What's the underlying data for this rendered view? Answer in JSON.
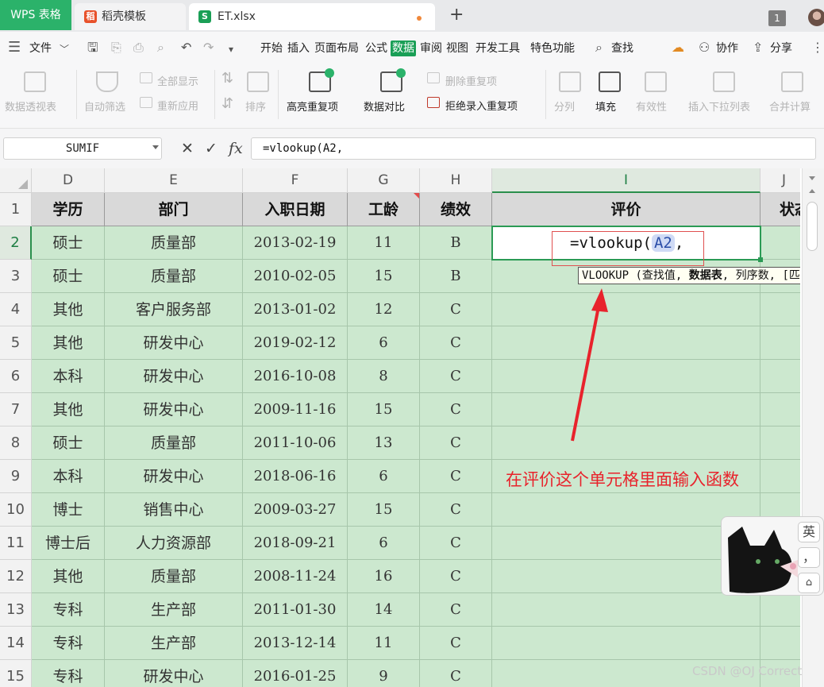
{
  "app": {
    "wps_tab_label": "WPS 表格",
    "tabs": [
      {
        "label": "稻壳模板",
        "icon": "daoke-icon",
        "icon_color": "#e8512a"
      },
      {
        "label": "ET.xlsx",
        "icon": "spreadsheet-icon",
        "icon_color": "#1a9f56",
        "active": true,
        "unsaved": true
      }
    ],
    "new_tab_label": "+",
    "window_count": "1"
  },
  "menu": {
    "items": [
      "文件",
      "开始",
      "插入",
      "页面布局",
      "公式",
      "数据",
      "审阅",
      "视图",
      "开发工具",
      "特色功能"
    ],
    "selected": "数据",
    "search_label": "查找",
    "collab_label": "协作",
    "share_label": "分享"
  },
  "ribbon": {
    "pivot": "数据透视表",
    "autofilter": "自动筛选",
    "show_all": "全部显示",
    "reapply": "重新应用",
    "sort": "排序",
    "highlight_dup": "高亮重复项",
    "compare": "数据对比",
    "remove_dup": "删除重复项",
    "reject_dup": "拒绝录入重复项",
    "split": "分列",
    "fill": "填充",
    "validity": "有效性",
    "insert_dropdown": "插入下拉列表",
    "consolidate": "合并计算"
  },
  "formula_bar": {
    "name_box": "SUMIF",
    "cancel_glyph": "✕",
    "confirm_glyph": "✓",
    "fx_label": "fx",
    "formula": "=vlookup(A2,"
  },
  "columns": [
    "D",
    "E",
    "F",
    "G",
    "H",
    "I",
    "J"
  ],
  "active_column": "I",
  "header_row": [
    "学历",
    "部门",
    "入职日期",
    "工龄",
    "绩效",
    "评价",
    "状态"
  ],
  "rows": [
    {
      "n": "2",
      "cells": [
        "硕士",
        "质量部",
        "2013-02-19",
        "11",
        "B"
      ]
    },
    {
      "n": "3",
      "cells": [
        "硕士",
        "质量部",
        "2010-02-05",
        "15",
        "B"
      ]
    },
    {
      "n": "4",
      "cells": [
        "其他",
        "客户服务部",
        "2013-01-02",
        "12",
        "C"
      ]
    },
    {
      "n": "5",
      "cells": [
        "其他",
        "研发中心",
        "2019-02-12",
        "6",
        "C"
      ]
    },
    {
      "n": "6",
      "cells": [
        "本科",
        "研发中心",
        "2016-10-08",
        "8",
        "C"
      ]
    },
    {
      "n": "7",
      "cells": [
        "其他",
        "研发中心",
        "2009-11-16",
        "15",
        "C"
      ]
    },
    {
      "n": "8",
      "cells": [
        "硕士",
        "质量部",
        "2011-10-06",
        "13",
        "C"
      ]
    },
    {
      "n": "9",
      "cells": [
        "本科",
        "研发中心",
        "2018-06-16",
        "6",
        "C"
      ]
    },
    {
      "n": "10",
      "cells": [
        "博士",
        "销售中心",
        "2009-03-27",
        "15",
        "C"
      ]
    },
    {
      "n": "11",
      "cells": [
        "博士后",
        "人力资源部",
        "2018-09-21",
        "6",
        "C"
      ]
    },
    {
      "n": "12",
      "cells": [
        "其他",
        "质量部",
        "2008-11-24",
        "16",
        "C"
      ]
    },
    {
      "n": "13",
      "cells": [
        "专科",
        "生产部",
        "2011-01-30",
        "14",
        "C"
      ]
    },
    {
      "n": "14",
      "cells": [
        "专科",
        "生产部",
        "2013-12-14",
        "11",
        "C"
      ]
    },
    {
      "n": "15",
      "cells": [
        "专科",
        "研发中心",
        "2016-01-25",
        "9",
        "C"
      ]
    }
  ],
  "header_row_number": "1",
  "edit_cell": {
    "prefix": "=vlookup(",
    "ref": "A2",
    "suffix": ","
  },
  "tooltip": {
    "fn": "VLOOKUP",
    "arg1": "(查找值,",
    "arg2": "数据表",
    "arg3": ", 列序数, [匹"
  },
  "annotation": {
    "text": "在评价这个单元格里面输入函数",
    "color": "#e8232c"
  },
  "ime": {
    "lang_key": "英",
    "punct_key": "，",
    "skin_key": "👕"
  },
  "watermark": "CSDN @OJ Correct"
}
